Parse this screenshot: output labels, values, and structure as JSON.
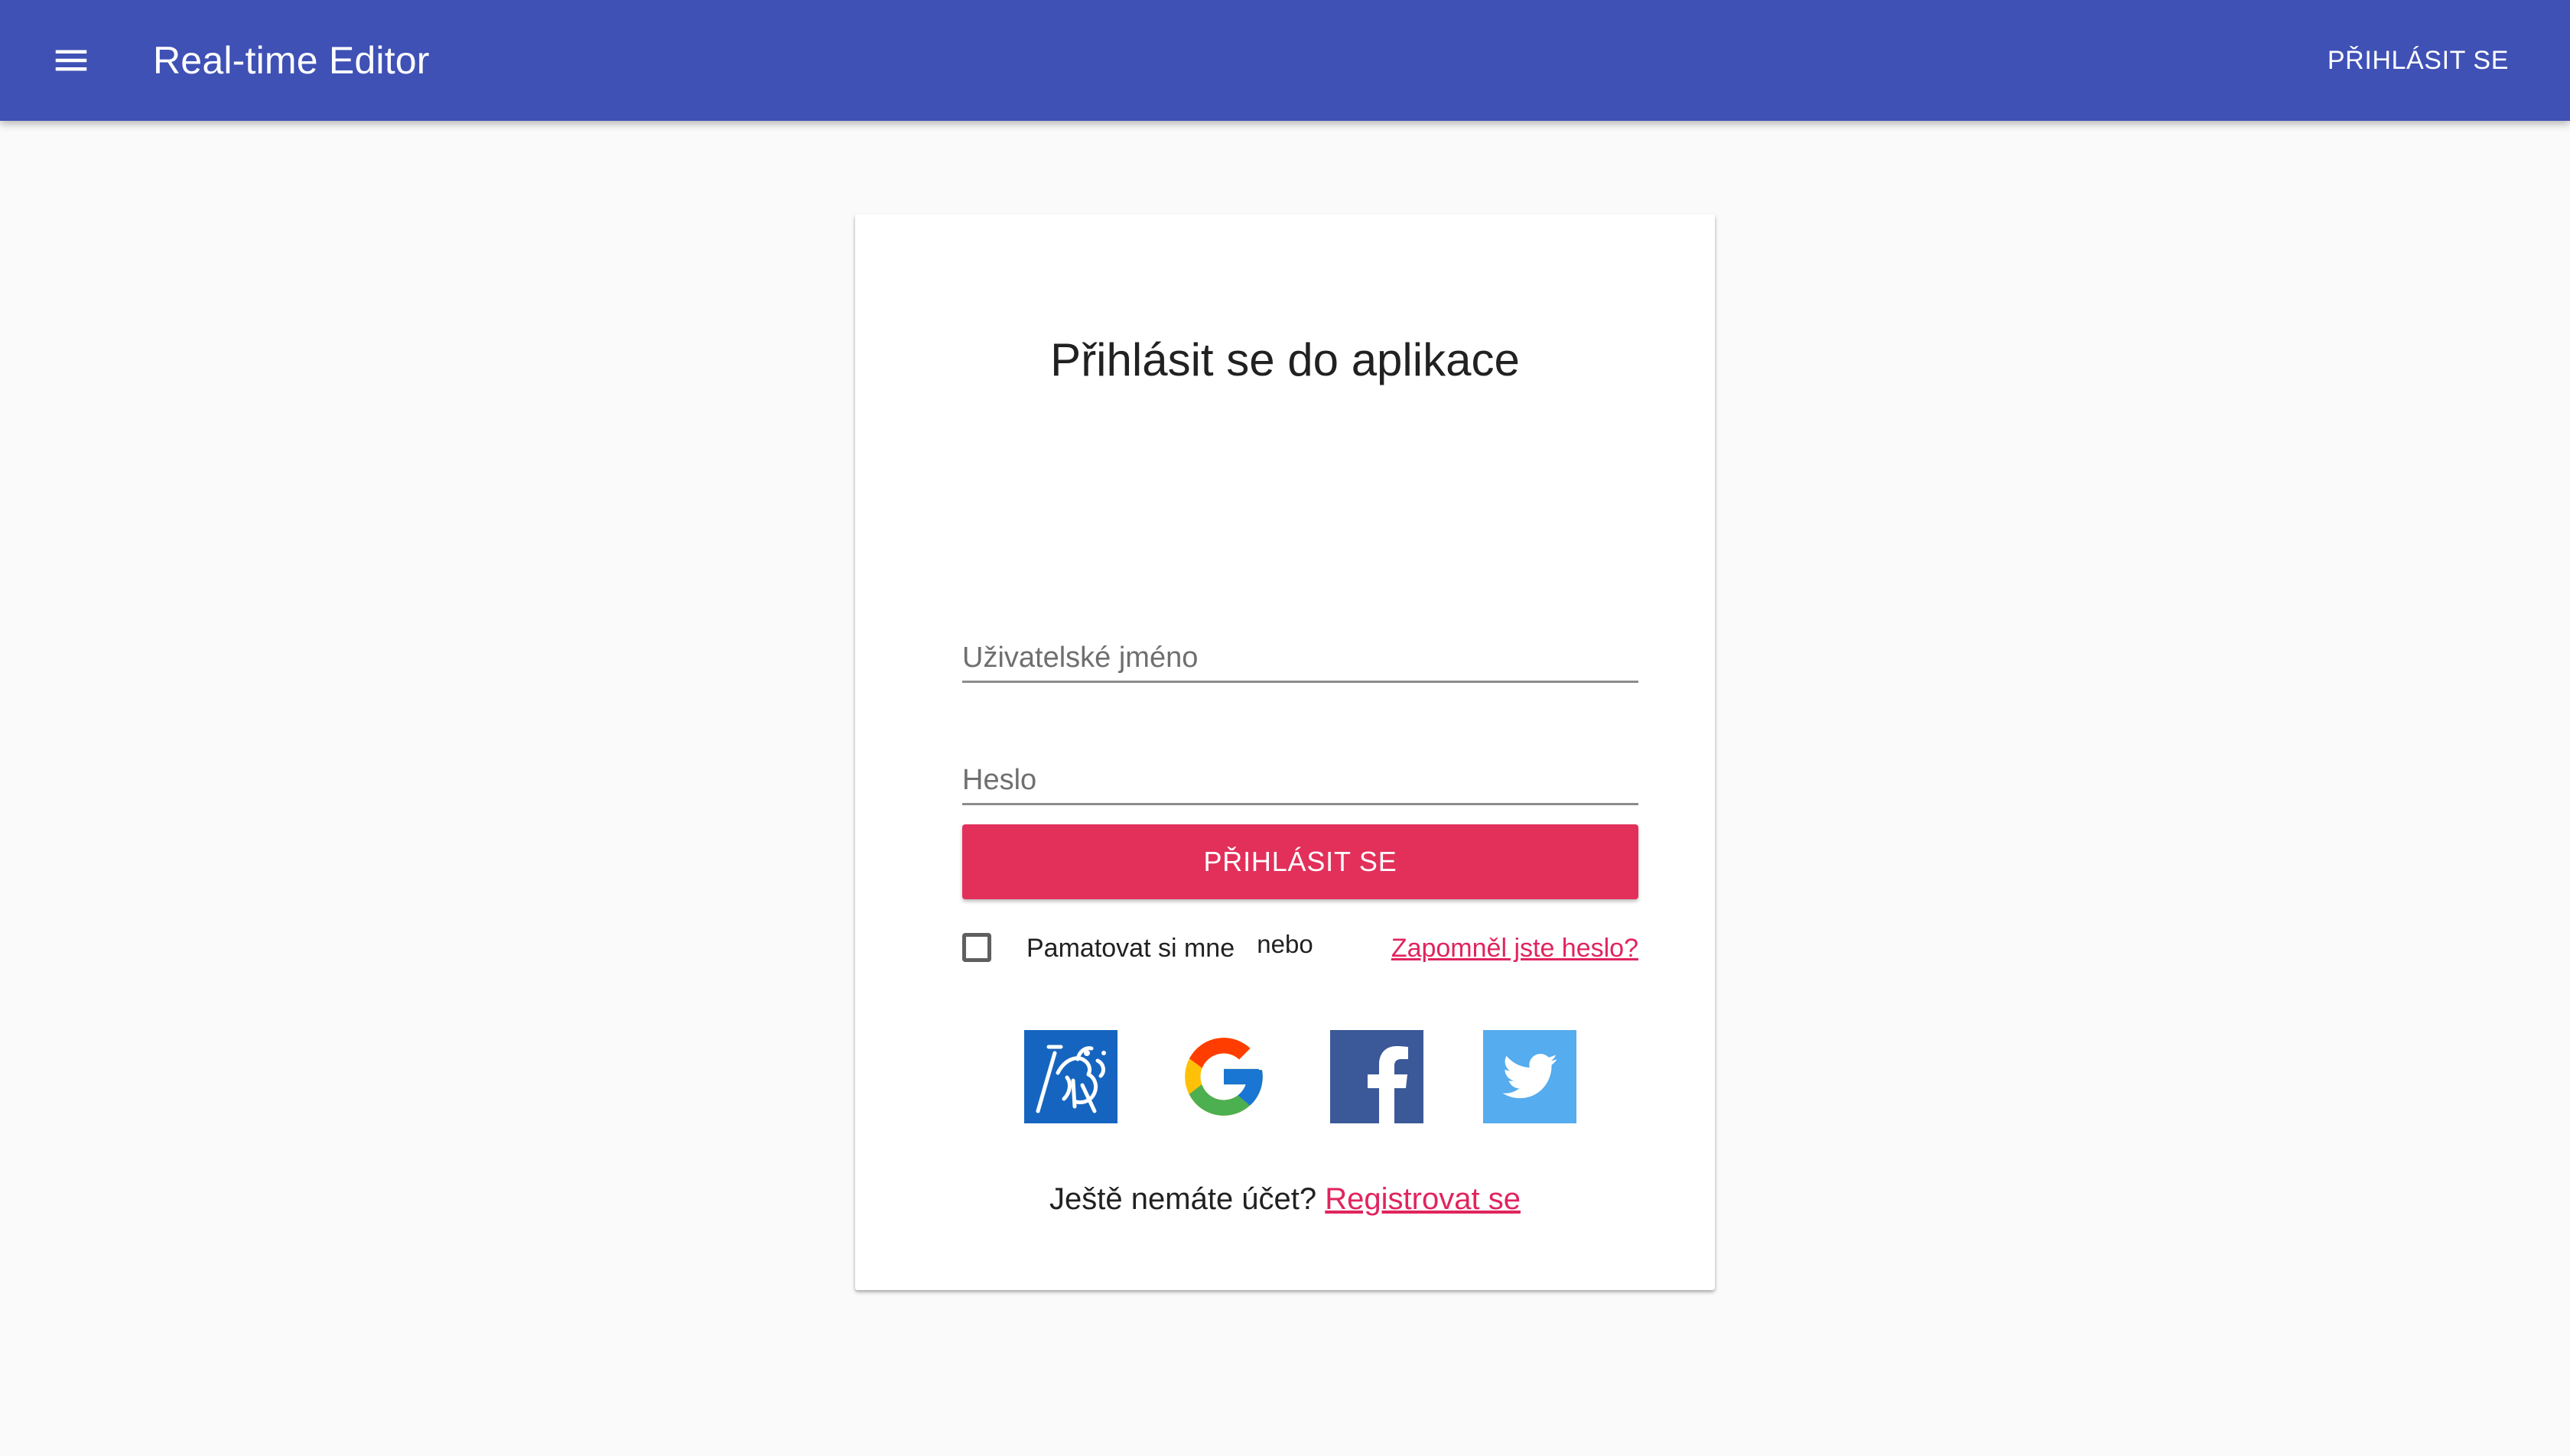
{
  "appbar": {
    "title": "Real-time Editor",
    "login_label": "PŘIHLÁSIT SE",
    "color": "#3f51b5",
    "menu_icon": "menu-icon"
  },
  "login_card": {
    "title": "Přihlásit se do aplikace",
    "username": {
      "placeholder": "Uživatelské jméno",
      "value": ""
    },
    "password": {
      "placeholder": "Heslo",
      "value": ""
    },
    "remember_me": {
      "label": "Pamatovat si mne",
      "checked": false
    },
    "forgot_password_link": "Zapomněl jste heslo?",
    "submit_label": "PŘIHLÁSIT SE",
    "submit_color": "#e2305a",
    "or_label": "nebo",
    "social_providers": [
      {
        "name": "cvut-icon",
        "color": "#1565c0"
      },
      {
        "name": "google-icon",
        "color": "#4285f4"
      },
      {
        "name": "facebook-icon",
        "color": "#3b5998"
      },
      {
        "name": "twitter-icon",
        "color": "#55acee"
      }
    ],
    "register_prompt": "Ještě nemáte účet?",
    "register_link": "Registrovat se",
    "link_color": "#e0245e"
  }
}
